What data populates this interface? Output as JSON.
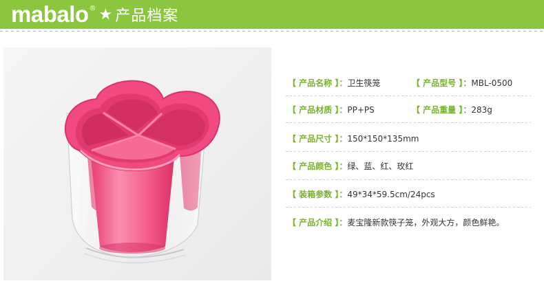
{
  "header": {
    "brand": "mabalo",
    "reg_mark": "®",
    "star": "★",
    "title": "产品档案"
  },
  "colors": {
    "header_bg": "#8cc63f",
    "label": "#7ab22f",
    "product_pink": "#f0467c"
  },
  "specs": {
    "name_label": "【 产品名称 】：",
    "name_value": "卫生筷笼",
    "model_label": "【 产品型号 】：",
    "model_value": "MBL-0500",
    "material_label": "【 产品材质 】：",
    "material_value": "PP+PS",
    "weight_label": "【 产品重量 】：",
    "weight_value": "283g",
    "size_label": "【 产品尺寸 】：",
    "size_value": "150*150*135mm",
    "color_label": "【 产品颜色 】：",
    "color_value": "绿、蓝、红、玫红",
    "packing_label": "【 装箱参数 】：",
    "packing_value": "49*34*59.5cm/24pcs",
    "intro_label": "【 产品介绍 】：",
    "intro_value": "麦宝隆新款筷子笼，外观大方，颜色鲜艳。"
  }
}
